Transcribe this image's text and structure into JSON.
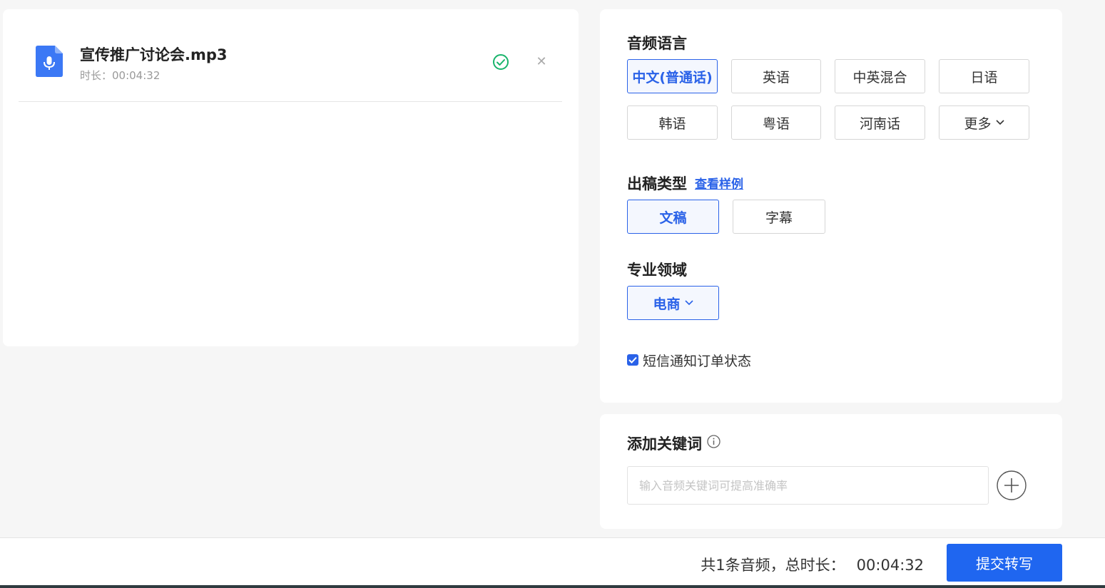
{
  "file": {
    "name": "宣传推广讨论会.mp3",
    "duration_label": "时长：00:04:32"
  },
  "settings": {
    "audio_language": {
      "title": "音频语言",
      "options": [
        "中文(普通话)",
        "英语",
        "中英混合",
        "日语",
        "韩语",
        "粤语",
        "河南话",
        "更多"
      ],
      "selected": "中文(普通话)"
    },
    "output_type": {
      "title": "出稿类型",
      "sample_link": "查看样例",
      "options": [
        "文稿",
        "字幕"
      ],
      "selected": "文稿"
    },
    "domain": {
      "title": "专业领域",
      "value": "电商"
    },
    "sms_notify": {
      "label": "短信通知订单状态",
      "checked": true
    }
  },
  "keywords": {
    "title": "添加关键词",
    "placeholder": "输入音频关键词可提高准确率"
  },
  "footer": {
    "count_text": "共1条音频，",
    "total_label": "总时长：",
    "total_value": "00:04:32",
    "submit_label": "提交转写"
  },
  "colors": {
    "accent": "#2a62e8",
    "submit": "#1f66f0",
    "success": "#18b46b"
  }
}
